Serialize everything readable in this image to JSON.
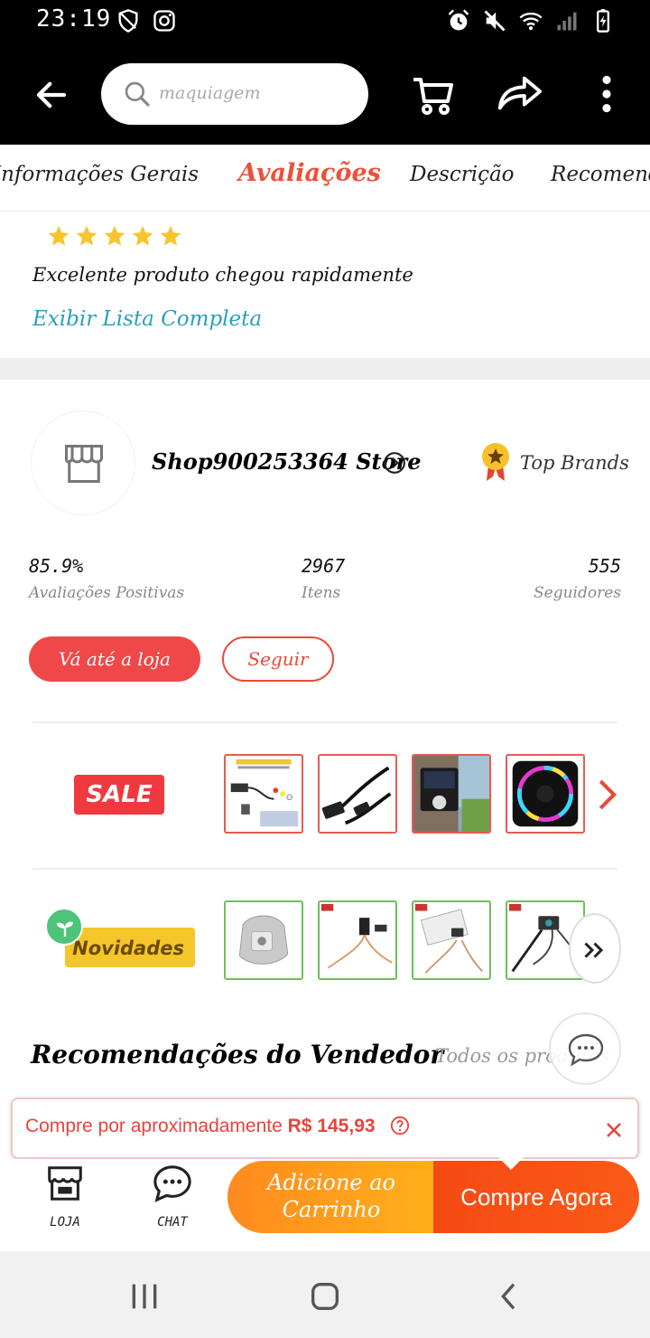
{
  "status_bar": {
    "time": "23:19",
    "left_icons": [
      "shield-icon",
      "instagram-icon"
    ],
    "right_icons": [
      "alarm-icon",
      "mute-icon",
      "wifi-icon",
      "signal-icon",
      "battery-icon"
    ]
  },
  "header": {
    "search_placeholder": "maquiagem",
    "icons": [
      "back-arrow-icon",
      "search-icon",
      "cart-icon",
      "share-icon",
      "more-vertical-icon"
    ]
  },
  "tabs": [
    {
      "label": "Informações Gerais",
      "active": false
    },
    {
      "label": "Avaliações",
      "active": true
    },
    {
      "label": "Descrição",
      "active": false
    },
    {
      "label": "Recomendações",
      "active": false
    }
  ],
  "review": {
    "stars": 5,
    "text": "Excelente produto chegou rapidamente",
    "full_list_link": "Exibir Lista Completa"
  },
  "store": {
    "name": "Shop900253364 Store",
    "badge": "Top Brands",
    "stats": [
      {
        "value": "85.9%",
        "label": "Avaliações Positivas"
      },
      {
        "value": "2967",
        "label": "Itens"
      },
      {
        "value": "555",
        "label": "Seguidores"
      }
    ],
    "visit_button": "Vá até a loja",
    "follow_button": "Seguir",
    "sale_label": "SALE",
    "new_label": "Novidades"
  },
  "recommendations": {
    "title": "Recomendações do Vendedor",
    "all_link": "Todos os produtos"
  },
  "toast": {
    "prefix": "Compre por aproximadamente ",
    "price": "R$ 145,93"
  },
  "bottom_bar": {
    "store_label": "LOJA",
    "chat_label": "CHAT",
    "add_to_cart": "Adicione ao Carrinho",
    "buy_now": "Compre Agora"
  },
  "colors": {
    "accent": "#f04f3a",
    "link": "#2a9fbb",
    "star": "#f7c52c",
    "add_cart": "#ff9a1c",
    "buy_now": "#f54a12"
  }
}
